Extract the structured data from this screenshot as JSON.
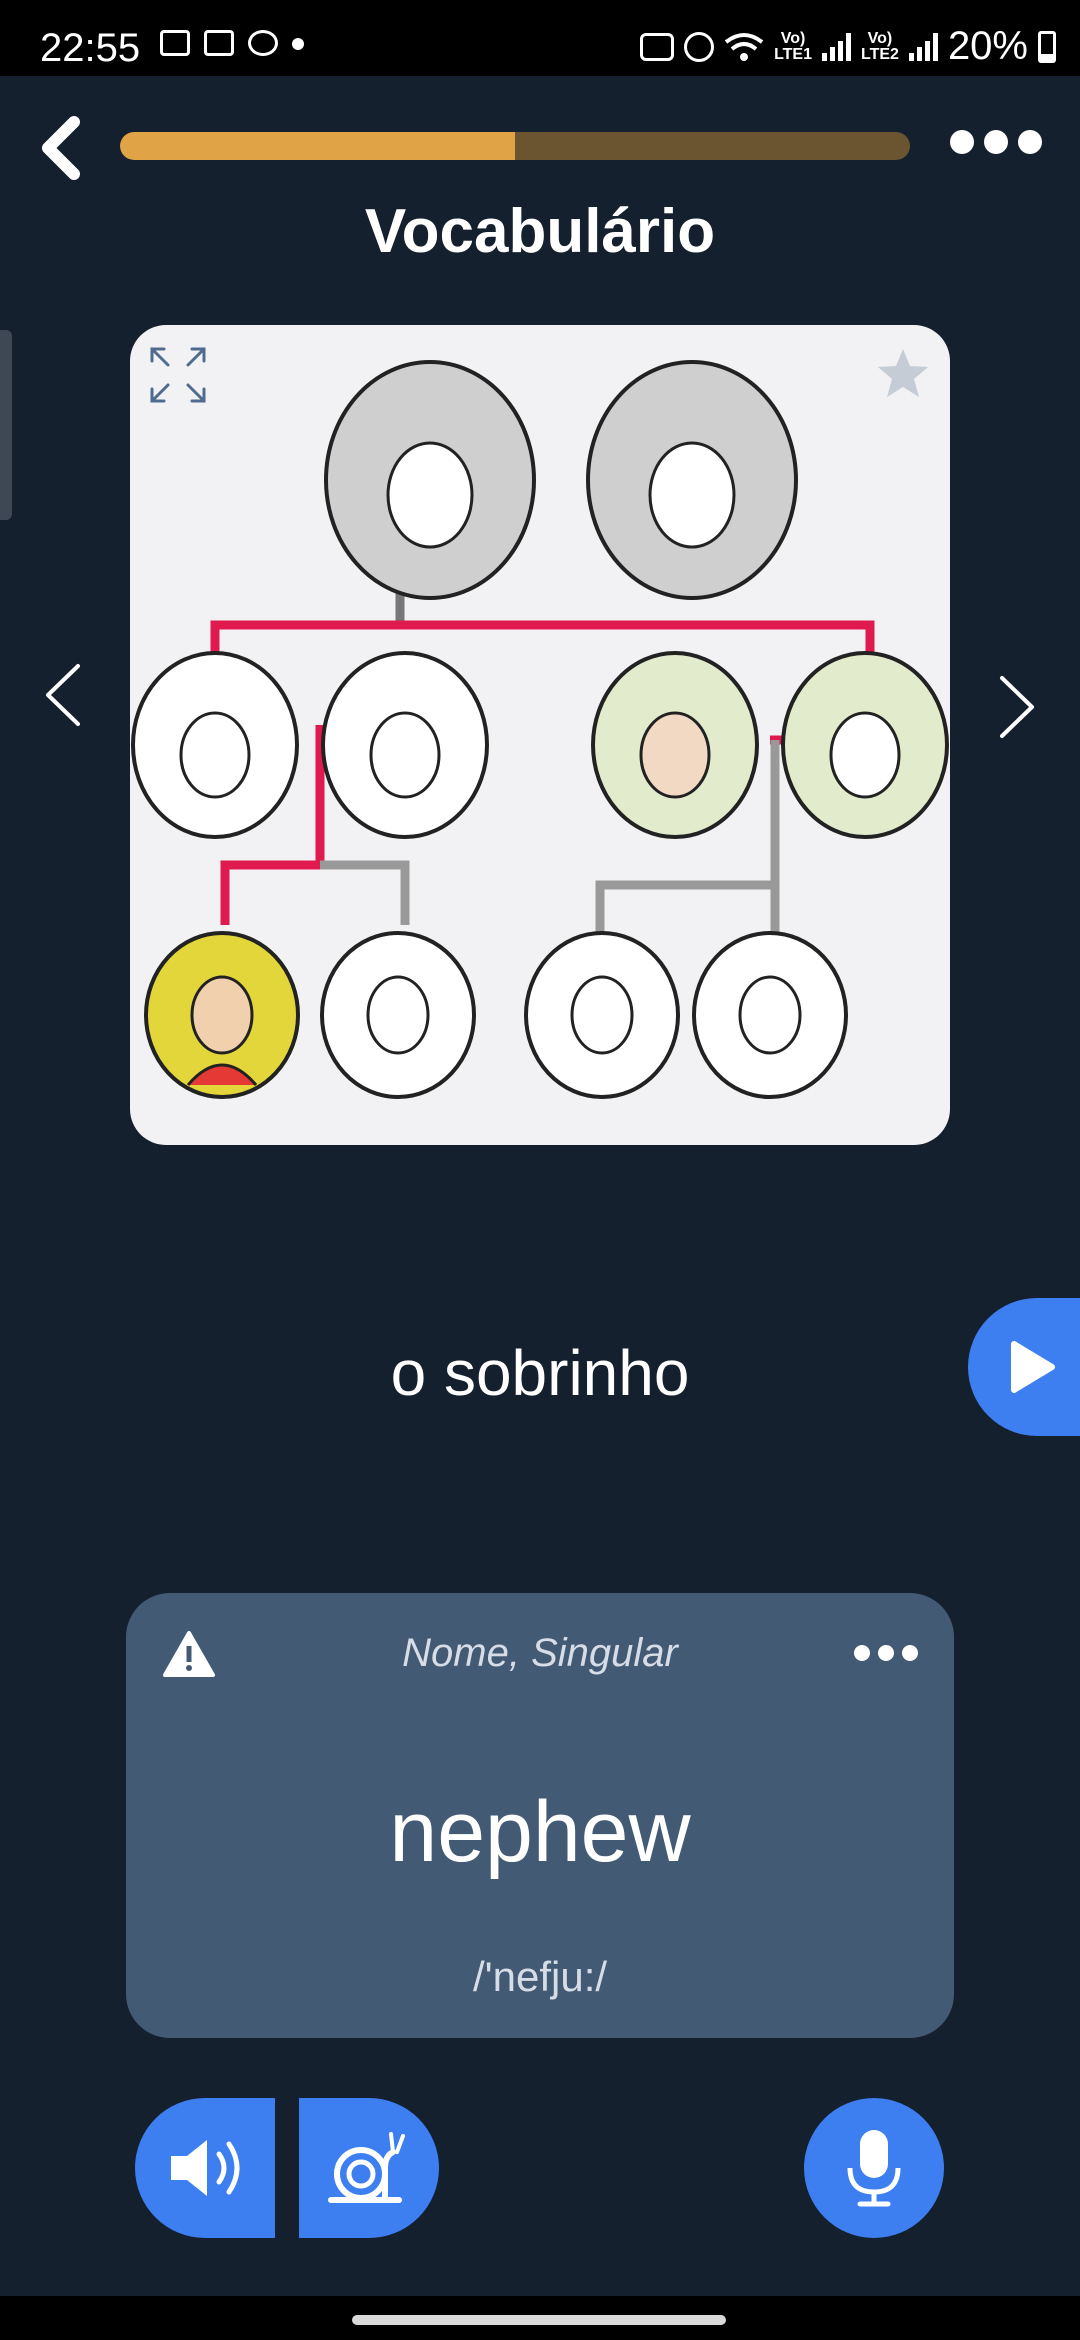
{
  "status_bar": {
    "time": "22:55",
    "battery": "20%",
    "icons": [
      "screenshot-icon",
      "screen-record-icon",
      "edge-icon",
      "dot-icon",
      "bed-icon",
      "alarm-icon",
      "wifi-icon",
      "volte-lte1-icon",
      "signal-icon",
      "volte-lte2-icon",
      "signal-icon",
      "battery-icon"
    ]
  },
  "header": {
    "title": "Vocabulário",
    "progress": 0.5,
    "back_icon": "chevron-left-icon",
    "more_icon": "more-horizontal-icon"
  },
  "image_card": {
    "expand_icon": "expand-icon",
    "favorite_icon": "star-icon",
    "illustration": "family-tree"
  },
  "word": {
    "portuguese": "o sobrinho",
    "play_icon": "play-icon"
  },
  "translation": {
    "type": "Nome, Singular",
    "word": "nephew",
    "phonetic": "/'nefju:/",
    "warning_icon": "warning-icon",
    "more_icon": "more-horizontal-icon"
  },
  "buttons": {
    "audio_icon": "speaker-icon",
    "slow_icon": "snail-icon",
    "mic_icon": "microphone-icon"
  },
  "colors": {
    "background": "#14202e",
    "accent": "#3d7ff0",
    "progress": "#e0a345",
    "card": "#435a75"
  }
}
